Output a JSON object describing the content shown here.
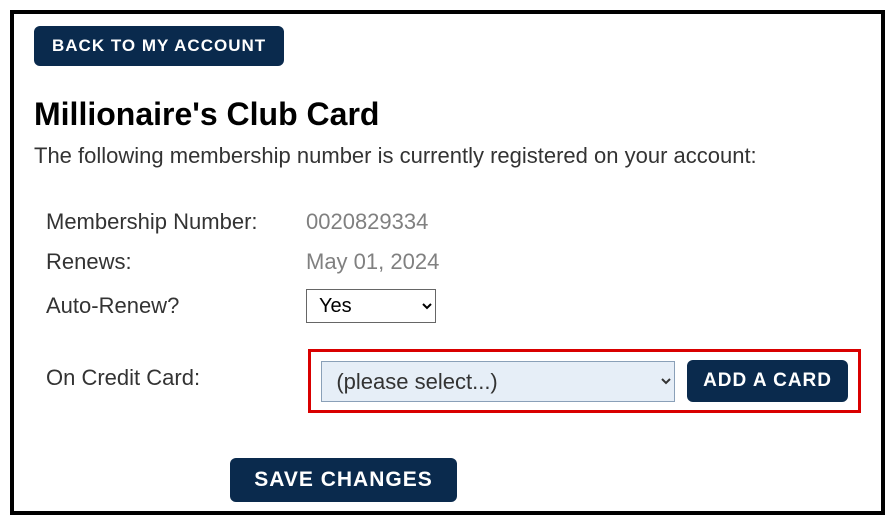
{
  "back_button": "BACK TO MY ACCOUNT",
  "title": "Millionaire's Club Card",
  "subtitle": "The following membership number is currently registered on your account:",
  "fields": {
    "membership_label": "Membership Number:",
    "membership_value": "0020829334",
    "renews_label": "Renews:",
    "renews_value": "May 01, 2024",
    "autorenew_label": "Auto-Renew?",
    "autorenew_value": "Yes",
    "creditcard_label": "On Credit Card:",
    "creditcard_value": "(please select...)"
  },
  "add_card_button": "ADD A CARD",
  "save_button": "SAVE CHANGES"
}
